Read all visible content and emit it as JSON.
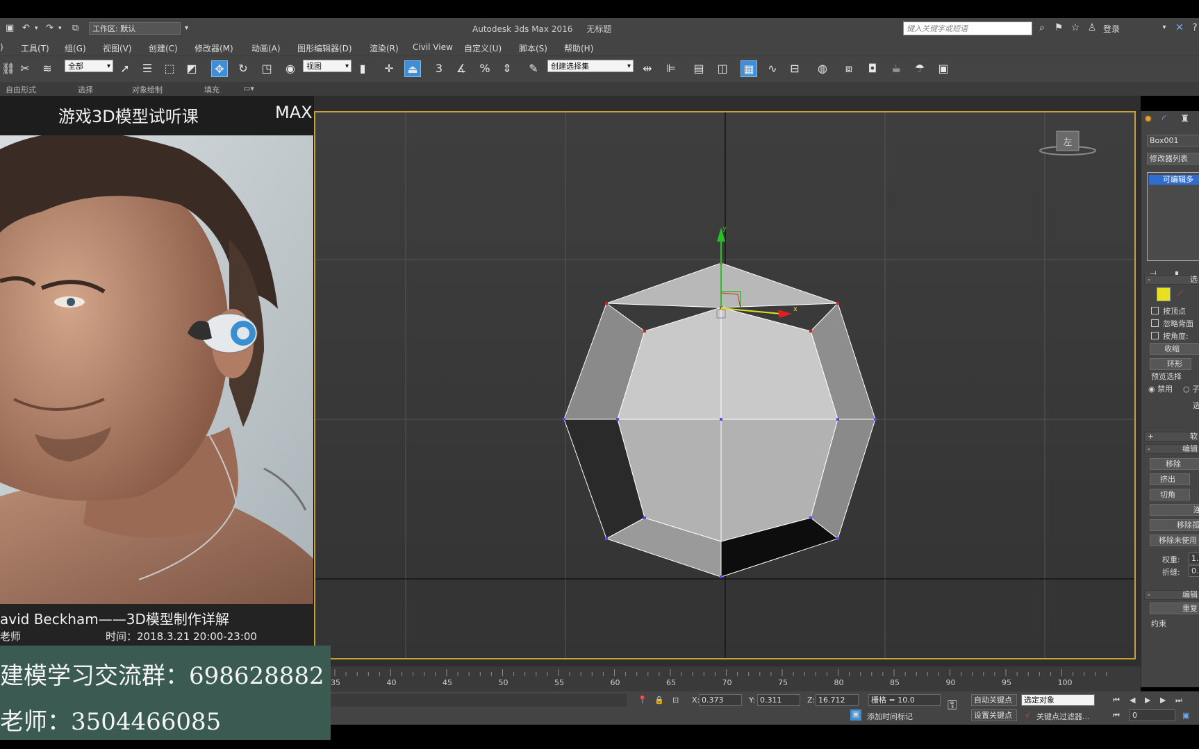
{
  "window": {
    "app_title": "Autodesk 3ds Max 2016",
    "doc_title": "无标题",
    "workspace": "工作区: 默认",
    "search_placeholder": "键入关键字或短语",
    "login": "登录"
  },
  "menu": [
    "工具(T)",
    "组(G)",
    "视图(V)",
    "创建(C)",
    "修改器(M)",
    "动画(A)",
    "图形编辑器(D)",
    "渲染(R)",
    "Civil View",
    "自定义(U)",
    "脚本(S)",
    "帮助(H)"
  ],
  "toolbar": {
    "filter_select": "全部",
    "coord_select": "视图",
    "selection_set": "创建选择集",
    "snap_label": "3",
    "percent_label": "%"
  },
  "ribbon": [
    "自由形式",
    "选择",
    "对象绘制",
    "填充"
  ],
  "overlay": {
    "course_title": "游戏3D模型试听课",
    "software": "MAX",
    "caption": "avid Beckham——3D模型制作详解",
    "teacher": "老师",
    "time": "时间：2018.3.21     20:00-23:00",
    "group_line": "建模学习交流群：698628882",
    "teacher_line": "老师：3504466085"
  },
  "viewport": {
    "view_cube_label": "左"
  },
  "command_panel": {
    "object_name": "Box001",
    "modifier_list": "修改器列表",
    "stack_item": "可编辑多",
    "rollout_select": "选",
    "by_vertex": "按顶点",
    "ignore_backface": "忽略背面",
    "by_angle": "按角度:",
    "shrink": "收缩",
    "ring": "环形",
    "preview_select": "预览选择",
    "disabled": "禁用",
    "sub": "子",
    "select_btn": "选",
    "soft_select": "软",
    "edit_section": "编辑",
    "move": "移除",
    "extrude": "挤出",
    "chamfer": "切角",
    "connect": "连",
    "remove_iso": "移除孤",
    "remove_unused": "移除未使用",
    "weight": "权重:",
    "weight_val": "1.",
    "crease": "折缝:",
    "crease_val": "0.",
    "edit_geo": "编辑",
    "repeat": "重复",
    "constraint": "约束"
  },
  "timeline": {
    "ticks": [
      "35",
      "40",
      "45",
      "50",
      "55",
      "60",
      "65",
      "70",
      "75",
      "80",
      "85",
      "90",
      "95",
      "100"
    ]
  },
  "status": {
    "x_label": "X:",
    "x_value": "0.373",
    "y_label": "Y:",
    "y_value": "0.311",
    "z_label": "Z:",
    "z_value": "16.712",
    "grid": "栅格 = 10.0",
    "auto_key": "自动关键点",
    "set_key": "设置关键点",
    "selected_object": "选定对象",
    "key_filter": "关键点过滤器...",
    "add_time_tag": "添加时间标记",
    "frame": "0"
  }
}
